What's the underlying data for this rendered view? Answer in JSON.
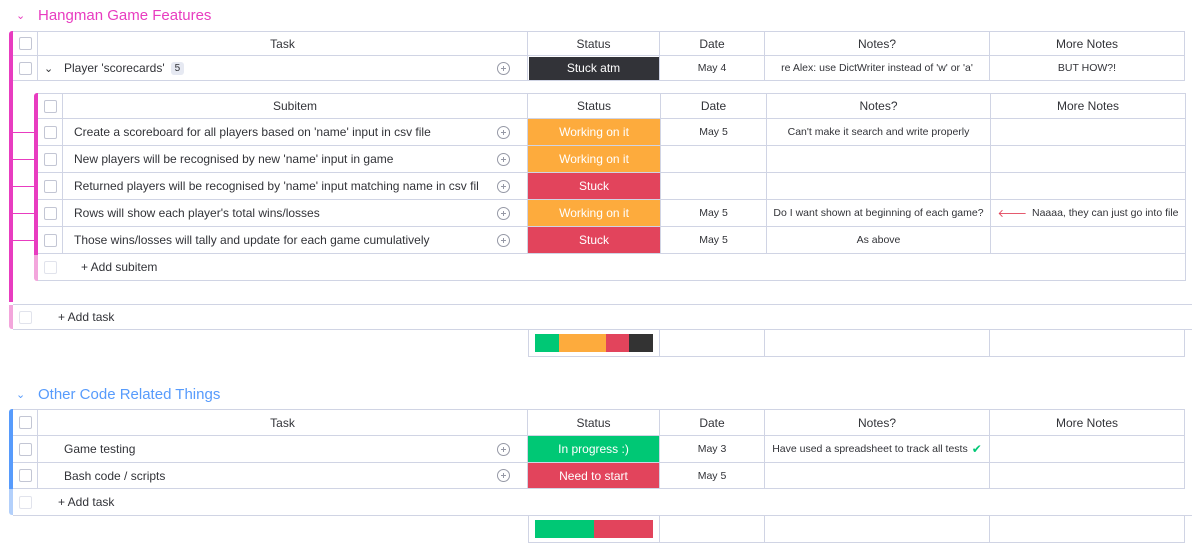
{
  "colors": {
    "group1": "#e2445c",
    "group1_title": "#e83cc0",
    "group2": "#579bfc",
    "working": "#fdab3d",
    "stuck": "#e2445c",
    "done": "#00c875",
    "dark": "#333333",
    "in_progress": "#00c875",
    "need_to_start": "#e2445c"
  },
  "group1": {
    "title": "Hangman Game Features",
    "headers": {
      "task": "Task",
      "status": "Status",
      "date": "Date",
      "notes": "Notes?",
      "more_notes": "More Notes"
    },
    "item": {
      "name": "Player 'scorecards'",
      "subitem_count": "5",
      "status": "Stuck atm",
      "date": "May 4",
      "notes": "re Alex: use DictWriter instead of 'w' or 'a'",
      "more_notes": "BUT HOW?!"
    },
    "sub_headers": {
      "subitem": "Subitem",
      "status": "Status",
      "date": "Date",
      "notes": "Notes?",
      "more_notes": "More Notes"
    },
    "subitems": [
      {
        "name": "Create a scoreboard for all players based on 'name' input in csv file",
        "status": "Working on it",
        "date": "May 5",
        "notes": "Can't make it search and write properly",
        "more_notes": ""
      },
      {
        "name": "New players will be recognised by new 'name' input in game",
        "status": "Working on it",
        "date": "",
        "notes": "",
        "more_notes": ""
      },
      {
        "name": "Returned players will be recognised by 'name' input matching name in csv file",
        "status": "Stuck",
        "date": "",
        "notes": "",
        "more_notes": ""
      },
      {
        "name": "Rows will show each player's total wins/losses",
        "status": "Working on it",
        "date": "May 5",
        "notes": "Do I want shown at beginning of each game?",
        "more_notes": "Naaaa, they can just go into file"
      },
      {
        "name": "Those wins/losses will tally and update for each game cumulatively",
        "status": "Stuck",
        "date": "May 5",
        "notes": "As above",
        "more_notes": ""
      }
    ],
    "add_subitem": "+ Add subitem",
    "add_task": "+ Add task",
    "summary": [
      {
        "color": "#00c875",
        "fraction": 0.2
      },
      {
        "color": "#fdab3d",
        "fraction": 0.4
      },
      {
        "color": "#e2445c",
        "fraction": 0.2
      },
      {
        "color": "#333333",
        "fraction": 0.2
      }
    ]
  },
  "group2": {
    "title": "Other Code Related Things",
    "headers": {
      "task": "Task",
      "status": "Status",
      "date": "Date",
      "notes": "Notes?",
      "more_notes": "More Notes"
    },
    "items": [
      {
        "name": "Game testing",
        "status": "In progress :)",
        "date": "May 3",
        "notes": "Have used a spreadsheet to track all tests",
        "more_notes": ""
      },
      {
        "name": "Bash code / scripts",
        "status": "Need to start",
        "date": "May 5",
        "notes": "",
        "more_notes": ""
      }
    ],
    "add_task": "+ Add task",
    "summary": [
      {
        "color": "#00c875",
        "fraction": 0.5
      },
      {
        "color": "#e2445c",
        "fraction": 0.5
      }
    ]
  }
}
